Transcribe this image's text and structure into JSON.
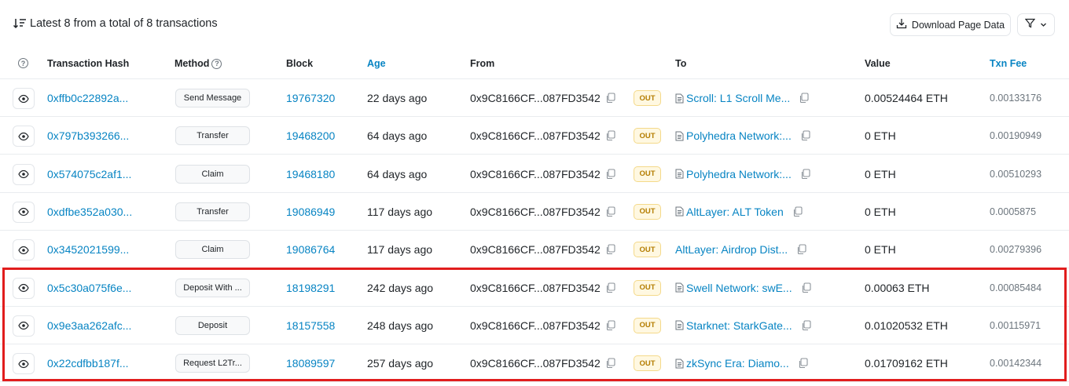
{
  "summary": {
    "text": "Latest 8 from a total of 8 transactions"
  },
  "toolbar": {
    "download_label": "Download Page Data"
  },
  "columns": {
    "hash": "Transaction Hash",
    "method": "Method",
    "block": "Block",
    "age": "Age",
    "from": "From",
    "to": "To",
    "value": "Value",
    "fee": "Txn Fee"
  },
  "rows": [
    {
      "hash": "0xffb0c22892a...",
      "method": "Send Message",
      "block": "19767320",
      "age": "22 days ago",
      "from": "0x9C8166CF...087FD3542",
      "direction": "OUT",
      "to": "Scroll: L1 Scroll Me...",
      "to_contract": true,
      "value": "0.00524464 ETH",
      "fee": "0.00133176"
    },
    {
      "hash": "0x797b393266...",
      "method": "Transfer",
      "block": "19468200",
      "age": "64 days ago",
      "from": "0x9C8166CF...087FD3542",
      "direction": "OUT",
      "to": "Polyhedra Network:...",
      "to_contract": true,
      "value": "0 ETH",
      "fee": "0.00190949"
    },
    {
      "hash": "0x574075c2af1...",
      "method": "Claim",
      "block": "19468180",
      "age": "64 days ago",
      "from": "0x9C8166CF...087FD3542",
      "direction": "OUT",
      "to": "Polyhedra Network:...",
      "to_contract": true,
      "value": "0 ETH",
      "fee": "0.00510293"
    },
    {
      "hash": "0xdfbe352a030...",
      "method": "Transfer",
      "block": "19086949",
      "age": "117 days ago",
      "from": "0x9C8166CF...087FD3542",
      "direction": "OUT",
      "to": "AltLayer: ALT Token",
      "to_contract": true,
      "value": "0 ETH",
      "fee": "0.0005875"
    },
    {
      "hash": "0x3452021599...",
      "method": "Claim",
      "block": "19086764",
      "age": "117 days ago",
      "from": "0x9C8166CF...087FD3542",
      "direction": "OUT",
      "to": "AltLayer: Airdrop Dist...",
      "to_contract": false,
      "value": "0 ETH",
      "fee": "0.00279396"
    },
    {
      "hash": "0x5c30a075f6e...",
      "method": "Deposit With ...",
      "block": "18198291",
      "age": "242 days ago",
      "from": "0x9C8166CF...087FD3542",
      "direction": "OUT",
      "to": "Swell Network: swE...",
      "to_contract": true,
      "value": "0.00063 ETH",
      "fee": "0.00085484"
    },
    {
      "hash": "0x9e3aa262afc...",
      "method": "Deposit",
      "block": "18157558",
      "age": "248 days ago",
      "from": "0x9C8166CF...087FD3542",
      "direction": "OUT",
      "to": "Starknet: StarkGate...",
      "to_contract": true,
      "value": "0.01020532 ETH",
      "fee": "0.00115971"
    },
    {
      "hash": "0x22cdfbb187f...",
      "method": "Request L2Tr...",
      "block": "18089597",
      "age": "257 days ago",
      "from": "0x9C8166CF...087FD3542",
      "direction": "OUT",
      "to": "zkSync Era: Diamo...",
      "to_contract": true,
      "value": "0.01709162 ETH",
      "fee": "0.00142344"
    }
  ],
  "colors": {
    "link": "#0784c3",
    "out_badge_bg": "#fff8e1",
    "out_badge_text": "#b47d00",
    "highlight": "#e11d1d"
  },
  "icons": [
    "sort-icon",
    "download-icon",
    "filter-icon",
    "chevron-down-icon",
    "question-icon",
    "eye-icon",
    "copy-icon",
    "contract-document-icon"
  ]
}
